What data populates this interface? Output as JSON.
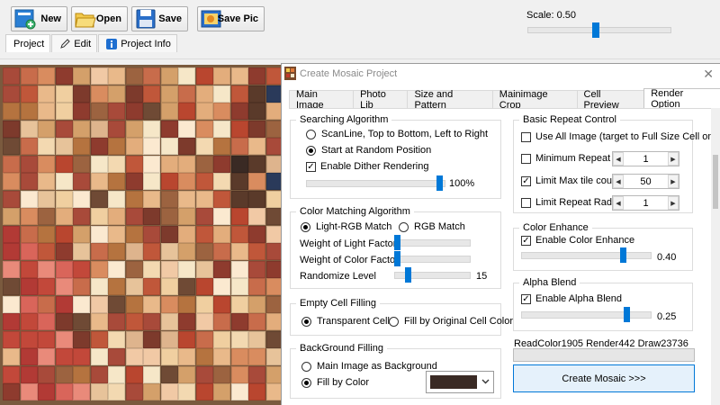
{
  "toolbar": {
    "new_label": "New",
    "open_label": "Open",
    "save_label": "Save",
    "save_pic_label": "Save Pic"
  },
  "subtabs": {
    "project": "Project",
    "edit": "Edit",
    "project_info": "Project Info"
  },
  "scale": {
    "label": "Scale: 0.50",
    "value": 0.5
  },
  "dialog": {
    "title": "Create Mosaic Project",
    "tabs": [
      "Main Image",
      "Photo Lib",
      "Size and Pattern",
      "Mainimage Crop",
      "Cell Preview",
      "Render Option"
    ],
    "active_tab": "Render Option"
  },
  "searching": {
    "title": "Searching Algorithm",
    "opt_scanline": "ScanLine, Top to Bottom, Left to Right",
    "opt_random": "Start at Random Position",
    "selected": "Start at Random Position",
    "dither_label": "Enable Dither Rendering",
    "dither_checked": true,
    "dither_value": "100%",
    "dither_level": 1.0
  },
  "color_matching": {
    "title": "Color Matching Algorithm",
    "opt_light_rgb": "Light-RGB Match",
    "opt_rgb": "RGB Match",
    "selected": "Light-RGB Match",
    "light_factor_label": "Weight of Light Factor",
    "color_factor_label": "Weight of Color Factor",
    "randomize_label": "Randomize Level",
    "randomize_value": "15"
  },
  "empty_cell": {
    "title": "Empty Cell Filling",
    "opt_transparent": "Transparent Cell",
    "opt_fill_original": "Fill by Original Cell Color",
    "selected": "Transparent Cell"
  },
  "background": {
    "title": "BackGround Filling",
    "opt_main_image": "Main Image as Background",
    "opt_fill_color": "Fill by Color",
    "selected": "Fill by Color",
    "fill_color": "#3a2a24"
  },
  "repeat": {
    "title": "Basic Repeat Control",
    "use_all_label": "Use All Image (target to Full Size Cell only)",
    "use_all_checked": false,
    "min_repeat_label": "Minimum Repeat",
    "min_repeat_checked": false,
    "min_repeat_value": "1",
    "limit_max_label": "Limit Max tile count",
    "limit_max_checked": true,
    "limit_max_value": "50",
    "limit_radius_label": "Limit Repeat Radius",
    "limit_radius_checked": false,
    "limit_radius_value": "1"
  },
  "color_enhance": {
    "title": "Color Enhance",
    "enable_label": "Enable Color Enhance",
    "checked": true,
    "value": "0.40"
  },
  "alpha_blend": {
    "title": "Alpha Blend",
    "enable_label": "Enable Alpha Blend",
    "checked": true,
    "value": "0.25"
  },
  "status": {
    "text": "ReadColor1905  Render442  Draw23736",
    "progress": 0
  },
  "create_button": "Create Mosaic >>>",
  "icons": {
    "new": "new-document-icon",
    "open": "open-folder-icon",
    "save": "floppy-disk-icon",
    "save_pic": "save-picture-icon",
    "edit": "pencil-icon",
    "info": "info-icon",
    "close": "close-icon"
  },
  "colors": {
    "accent": "#0078d7",
    "button_bg": "#e5f1fb"
  }
}
